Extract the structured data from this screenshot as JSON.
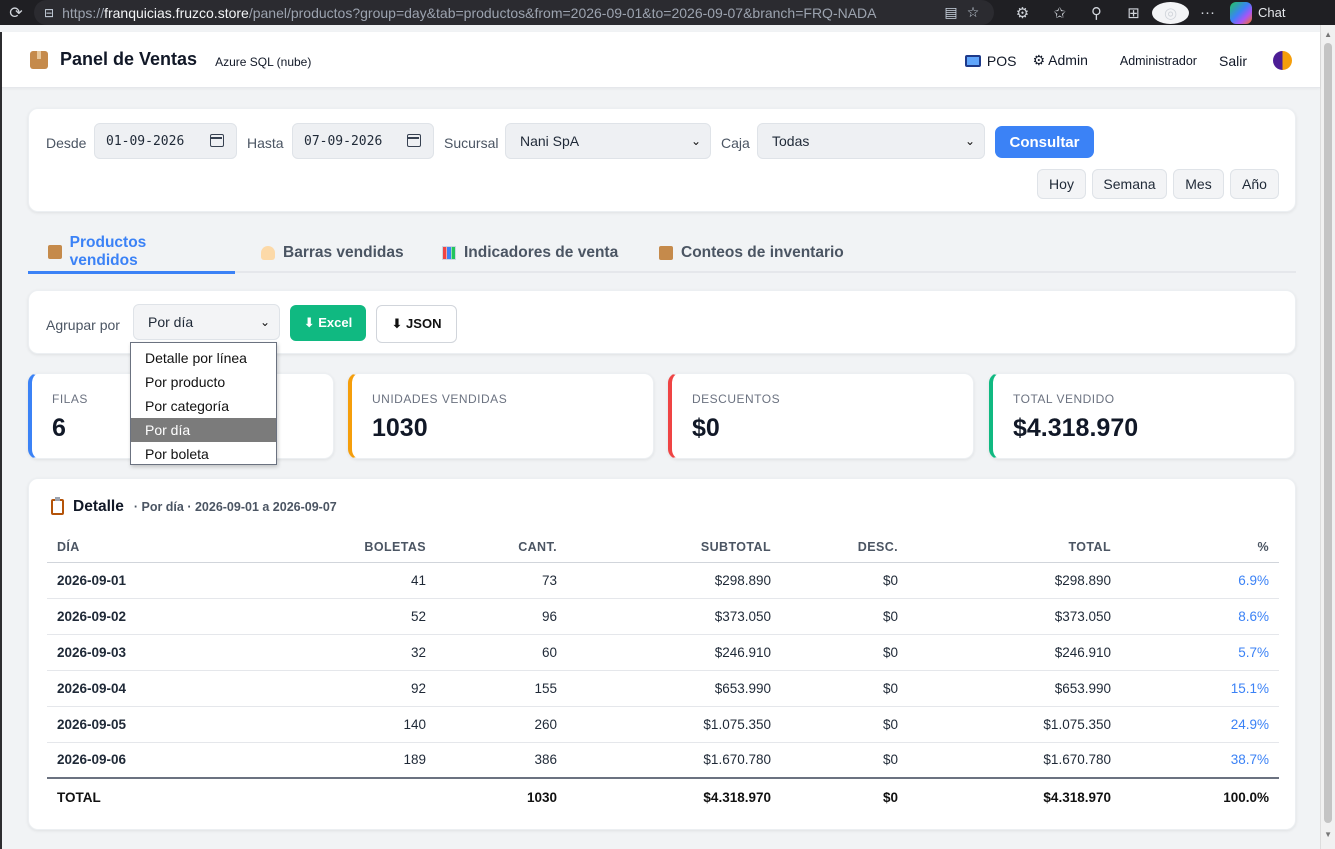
{
  "browser": {
    "url_prefix": "https://",
    "url_host": "franquicias.fruzco.store",
    "url_path": "/panel/productos?group=day&tab=productos&from=2026-09-01&to=2026-09-07&branch=FRQ-NADA",
    "chat_label": "Chat"
  },
  "header": {
    "title": "Panel de Ventas",
    "subtitle": "Azure SQL (nube)",
    "pos_label": "POS",
    "admin_label": "⚙ Admin",
    "user_label": "Administrador",
    "exit_label": "Salir"
  },
  "filters": {
    "from_label": "Desde",
    "from_value": "01-09-2026",
    "to_label": "Hasta",
    "to_value": "07-09-2026",
    "branch_label": "Sucursal",
    "branch_value": "Nani SpA",
    "register_label": "Caja",
    "register_value": "Todas",
    "submit_label": "Consultar",
    "quick": [
      "Hoy",
      "Semana",
      "Mes",
      "Año"
    ]
  },
  "tabs": [
    {
      "label": "Productos vendidos",
      "active": true
    },
    {
      "label": "Barras vendidas",
      "active": false
    },
    {
      "label": "Indicadores de venta",
      "active": false
    },
    {
      "label": "Conteos de inventario",
      "active": false
    }
  ],
  "group": {
    "label": "Agrupar por",
    "value": "Por día",
    "excel_label": "⬇ Excel",
    "json_label": "⬇ JSON",
    "options": [
      "Detalle por línea",
      "Por producto",
      "Por categoría",
      "Por día",
      "Por boleta"
    ],
    "selected_index": 3
  },
  "stats": [
    {
      "label": "FILAS",
      "value": "6",
      "color": "#3b82f6"
    },
    {
      "label": "UNIDADES VENDIDAS",
      "value": "1030",
      "color": "#f59e0b"
    },
    {
      "label": "DESCUENTOS",
      "value": "$0",
      "color": "#ef4444"
    },
    {
      "label": "TOTAL VENDIDO",
      "value": "$4.318.970",
      "color": "#10b981"
    }
  ],
  "detail": {
    "title": "Detalle",
    "subtitle": "· Por día · 2026-09-01 a 2026-09-07",
    "columns": [
      "DÍA",
      "BOLETAS",
      "CANT.",
      "SUBTOTAL",
      "DESC.",
      "TOTAL",
      "%"
    ],
    "rows": [
      [
        "2026-09-01",
        "41",
        "73",
        "$298.890",
        "$0",
        "$298.890",
        "6.9%"
      ],
      [
        "2026-09-02",
        "52",
        "96",
        "$373.050",
        "$0",
        "$373.050",
        "8.6%"
      ],
      [
        "2026-09-03",
        "32",
        "60",
        "$246.910",
        "$0",
        "$246.910",
        "5.7%"
      ],
      [
        "2026-09-04",
        "92",
        "155",
        "$653.990",
        "$0",
        "$653.990",
        "15.1%"
      ],
      [
        "2026-09-05",
        "140",
        "260",
        "$1.075.350",
        "$0",
        "$1.075.350",
        "24.9%"
      ],
      [
        "2026-09-06",
        "189",
        "386",
        "$1.670.780",
        "$0",
        "$1.670.780",
        "38.7%"
      ]
    ],
    "total": [
      "TOTAL",
      "",
      "1030",
      "$4.318.970",
      "$0",
      "$4.318.970",
      "100.0%"
    ]
  }
}
